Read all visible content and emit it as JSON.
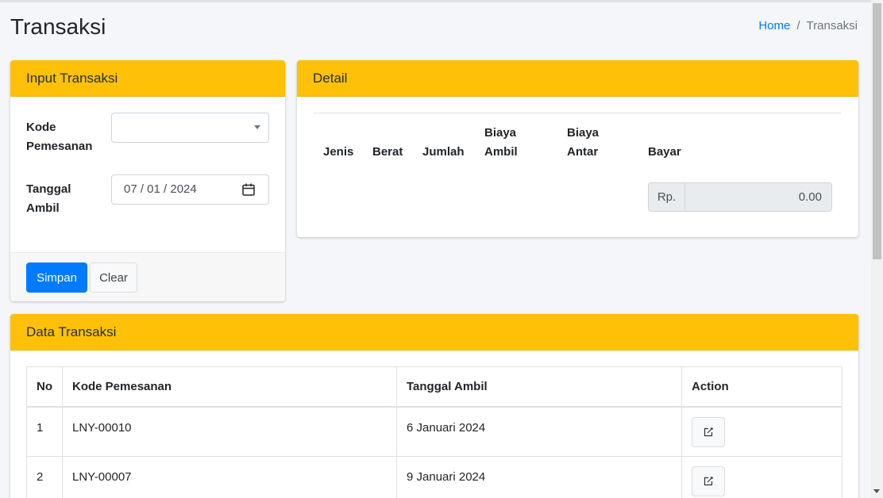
{
  "header": {
    "title": "Transaksi",
    "breadcrumb": {
      "home": "Home",
      "separator": "/",
      "current": "Transaksi"
    }
  },
  "input_card": {
    "title": "Input Transaksi",
    "kode_label": "Kode Pemesanan",
    "kode_value": "",
    "tanggal_label": "Tanggal Ambil",
    "tanggal_value": "07 / 01 / 2024",
    "save_label": "Simpan",
    "clear_label": "Clear"
  },
  "detail_card": {
    "title": "Detail",
    "columns": [
      "Jenis",
      "Berat",
      "Jumlah",
      "Biaya Ambil",
      "Biaya Antar",
      "Bayar"
    ],
    "currency_prefix": "Rp.",
    "bayar_value": "0.00"
  },
  "data_card": {
    "title": "Data Transaksi",
    "columns": [
      "No",
      "Kode Pemesanan",
      "Tanggal Ambil",
      "Action"
    ],
    "rows": [
      {
        "no": "1",
        "kode": "LNY-00010",
        "tanggal": "6 Januari 2024"
      },
      {
        "no": "2",
        "kode": "LNY-00007",
        "tanggal": "9 Januari 2024"
      }
    ]
  },
  "colors": {
    "header_bg": "#ffc107",
    "primary": "#007bff",
    "body_bg": "#f4f6f9"
  },
  "icons": {
    "calendar": "calendar-icon",
    "edit": "edit-icon",
    "caret": "chevron-down-icon"
  }
}
